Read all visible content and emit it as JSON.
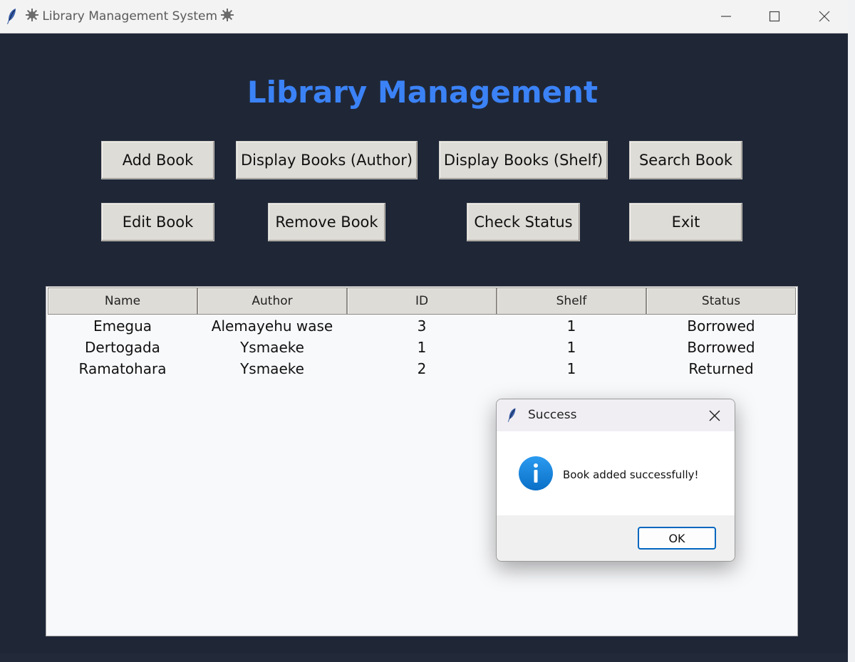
{
  "window": {
    "title": "Library Management System",
    "title_badge_icon": "gear-icon"
  },
  "heading": "Library Management",
  "buttons": {
    "add_book": "Add Book",
    "display_author": "Display Books (Author)",
    "display_shelf": "Display Books (Shelf)",
    "search_book": "Search Book",
    "edit_book": "Edit Book",
    "remove_book": "Remove Book",
    "check_status": "Check Status",
    "exit": "Exit"
  },
  "table": {
    "columns": [
      "Name",
      "Author",
      "ID",
      "Shelf",
      "Status"
    ],
    "rows": [
      [
        "Emegua",
        "Alemayehu wase",
        "3",
        "1",
        "Borrowed"
      ],
      [
        "Dertogada",
        "Ysmaeke",
        "1",
        "1",
        "Borrowed"
      ],
      [
        "Ramatohara",
        "Ysmaeke",
        "2",
        "1",
        "Returned"
      ]
    ]
  },
  "dialog": {
    "title": "Success",
    "message": "Book added successfully!",
    "ok_label": "OK",
    "icon": "info-icon"
  },
  "colors": {
    "background": "#1f2737",
    "heading": "#3b82f6",
    "button_face": "#dedcd7",
    "dialog_accent": "#0067c0"
  }
}
